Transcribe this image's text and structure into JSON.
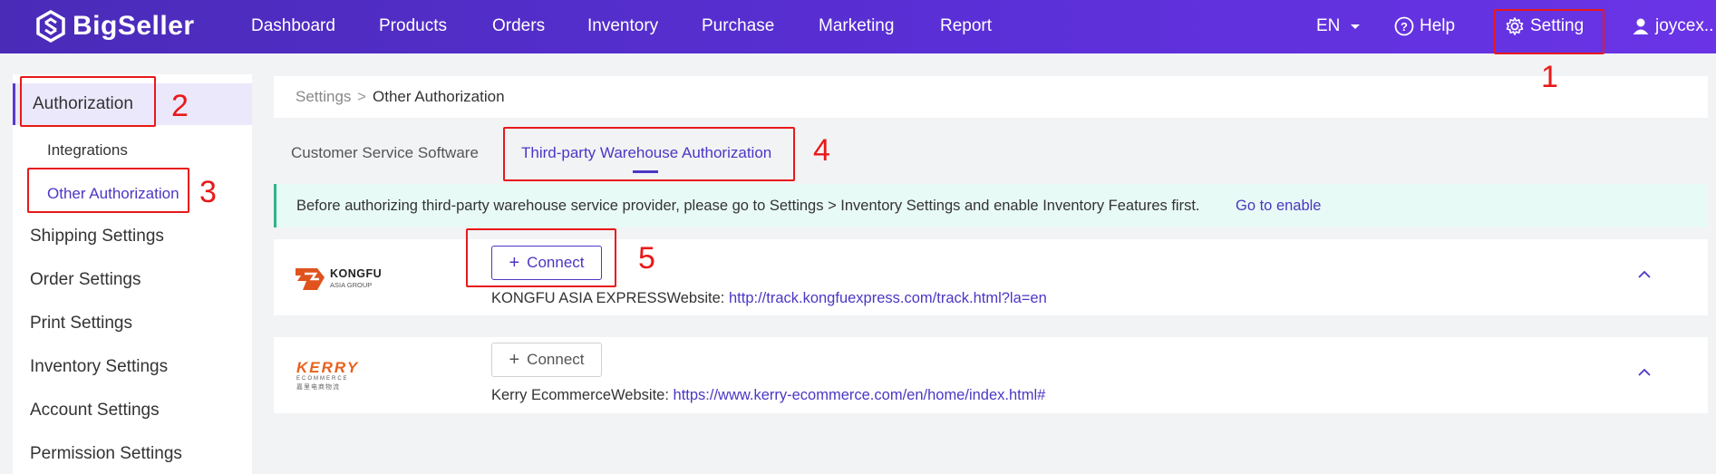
{
  "brand": {
    "name": "BigSeller"
  },
  "nav": {
    "items": [
      "Dashboard",
      "Products",
      "Orders",
      "Inventory",
      "Purchase",
      "Marketing",
      "Report"
    ],
    "language": "EN",
    "help": "Help",
    "setting": "Setting",
    "user": "joycex.."
  },
  "sidebar": {
    "authorization": "Authorization",
    "integrations": "Integrations",
    "other_authorization": "Other Authorization",
    "sections": [
      "Shipping Settings",
      "Order Settings",
      "Print Settings",
      "Inventory Settings",
      "Account Settings",
      "Permission Settings"
    ]
  },
  "breadcrumb": {
    "root": "Settings",
    "separator": ">",
    "current": "Other Authorization"
  },
  "tabs": {
    "customer_service": "Customer Service Software",
    "third_party_warehouse": "Third-party Warehouse Authorization"
  },
  "notice": {
    "text": "Before authorizing third-party warehouse service provider, please go to Settings > Inventory Settings and enable Inventory Features first.",
    "link": "Go to enable"
  },
  "warehouses": [
    {
      "logo_text": "KONGFU",
      "logo_sub": "ASIA GROUP",
      "connect_label": "Connect",
      "name": "KONGFU ASIA EXPRESS",
      "website_label": "Website: ",
      "url": "http://track.kongfuexpress.com/track.html?la=en"
    },
    {
      "logo_text": "KERRY",
      "logo_sub": "ECOMMERCE",
      "logo_cn": "嘉里电商物流",
      "connect_label": "Connect",
      "name": "Kerry Ecommerce",
      "website_label": "Website: ",
      "url": "https://www.kerry-ecommerce.com/en/home/index.html#"
    }
  ],
  "annotations": [
    "1",
    "2",
    "3",
    "4",
    "5"
  ],
  "colors": {
    "primary": "#4b37c4",
    "annotation": "#e8191a",
    "notice_bg": "#e8faf5",
    "notice_border": "#2fb38a"
  }
}
